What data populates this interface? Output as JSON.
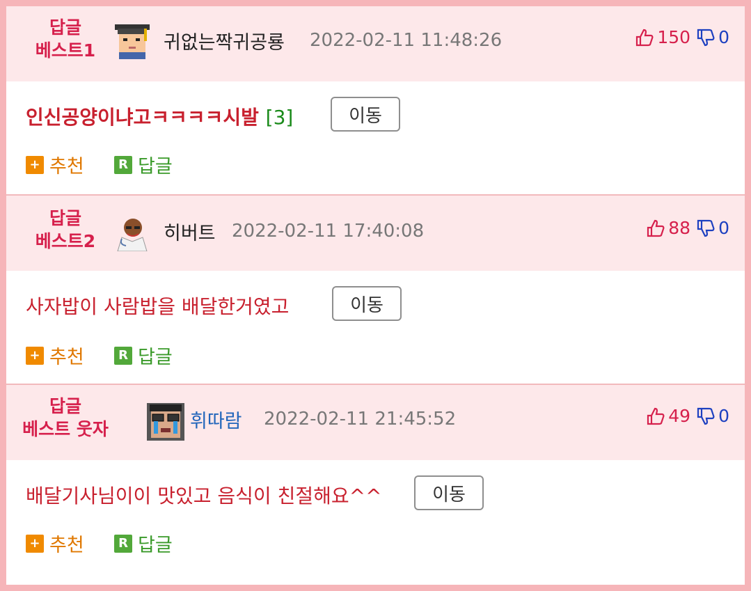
{
  "comments": [
    {
      "best_line1": "답글",
      "best_line2": "베스트1",
      "nickname": "귀없는짝귀공룡",
      "time": "2022-02-11 11:48:26",
      "likes": "150",
      "dislikes": "0",
      "text": "인신공양이냐고ㅋㅋㅋㅋ시발",
      "reply_count": "[3]",
      "move_label": "이동",
      "recommend_label": "추천",
      "reply_label": "답글"
    },
    {
      "best_line1": "답글",
      "best_line2": "베스트2",
      "nickname": "히버트",
      "time": "2022-02-11 17:40:08",
      "likes": "88",
      "dislikes": "0",
      "text": "사자밥이 사람밥을 배달한거였고",
      "move_label": "이동",
      "recommend_label": "추천",
      "reply_label": "답글"
    },
    {
      "best_line1": "답글",
      "best_line2": "베스트 웃자",
      "nickname": "휘따람",
      "time": "2022-02-11 21:45:52",
      "likes": "49",
      "dislikes": "0",
      "text": "배달기사님이이 맛있고 음식이 친절해요^^",
      "move_label": "이동",
      "recommend_label": "추천",
      "reply_label": "답글"
    }
  ],
  "icons": {
    "recommend": "plus-icon",
    "reply": "reply-r-icon",
    "like": "thumbs-up-icon",
    "dislike": "thumbs-down-icon"
  },
  "colors": {
    "border": "#f6b5b9",
    "header_bg": "#fde8ea",
    "best_label": "#d6204c",
    "comment_text": "#c8202e",
    "dislike": "#1d40c0",
    "recommend": "#f08a00",
    "reply": "#52a83a"
  }
}
